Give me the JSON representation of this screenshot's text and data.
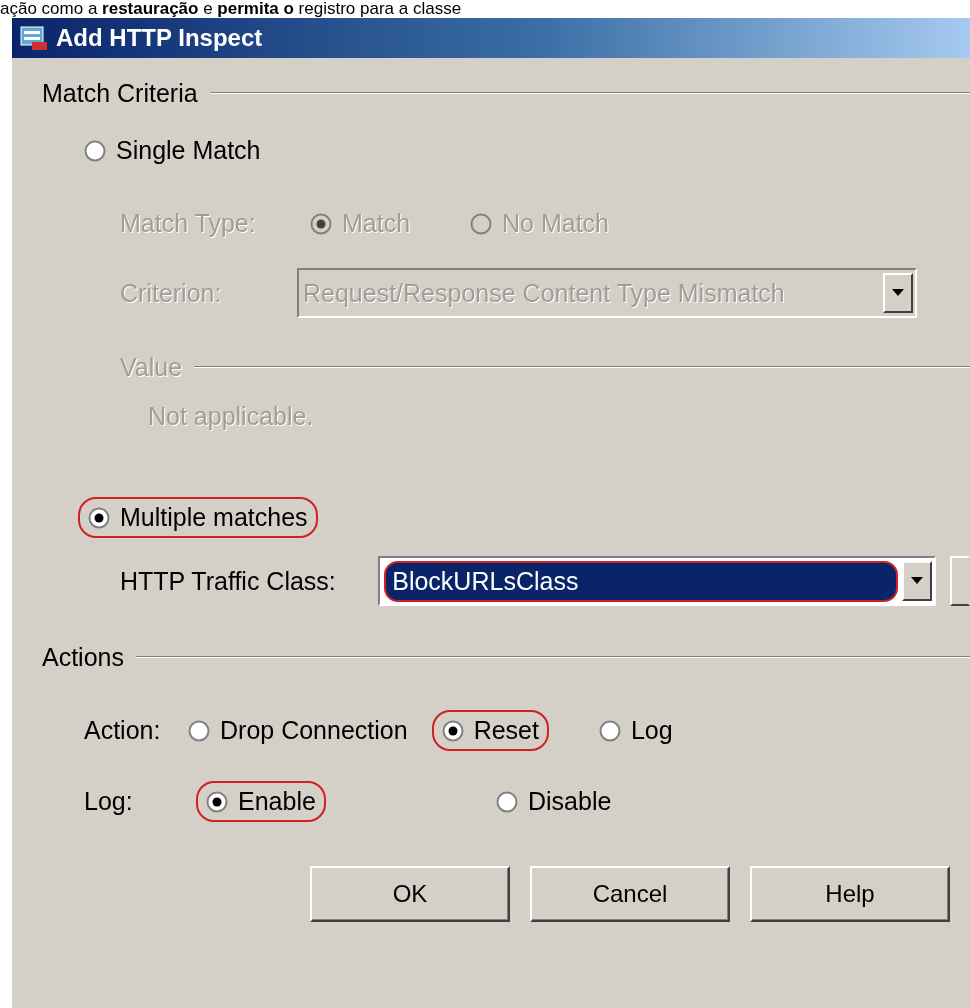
{
  "caption": "ação como a **restauração** e **permita o** registro para a classe",
  "window": {
    "title": "Add HTTP Inspect"
  },
  "match_criteria": {
    "label": "Match Criteria",
    "single_match": {
      "label": "Single Match",
      "selected": false,
      "circled": false
    },
    "match_type": {
      "label": "Match Type:",
      "disabled": true,
      "options": [
        {
          "label": "Match",
          "selected": true
        },
        {
          "label": "No Match",
          "selected": false
        }
      ]
    },
    "criterion": {
      "label": "Criterion:",
      "value": "Request/Response Content Type Mismatch",
      "disabled": true
    },
    "value": {
      "label": "Value",
      "text": "Not applicable.",
      "disabled": true
    },
    "multiple_matches": {
      "label": "Multiple matches",
      "selected": true,
      "circled": true
    },
    "traffic_class": {
      "label": "HTTP Traffic Class:",
      "value": "BlockURLsClass",
      "circled": true
    }
  },
  "actions": {
    "label": "Actions",
    "action": {
      "label": "Action:",
      "options": [
        {
          "label": "Drop Connection",
          "selected": false,
          "circled": false
        },
        {
          "label": "Reset",
          "selected": true,
          "circled": true
        },
        {
          "label": "Log",
          "selected": false,
          "circled": false
        }
      ]
    },
    "log": {
      "label": "Log:",
      "options": [
        {
          "label": "Enable",
          "selected": true,
          "circled": true
        },
        {
          "label": "Disable",
          "selected": false,
          "circled": false
        }
      ]
    }
  },
  "buttons": [
    "OK",
    "Cancel",
    "Help"
  ]
}
